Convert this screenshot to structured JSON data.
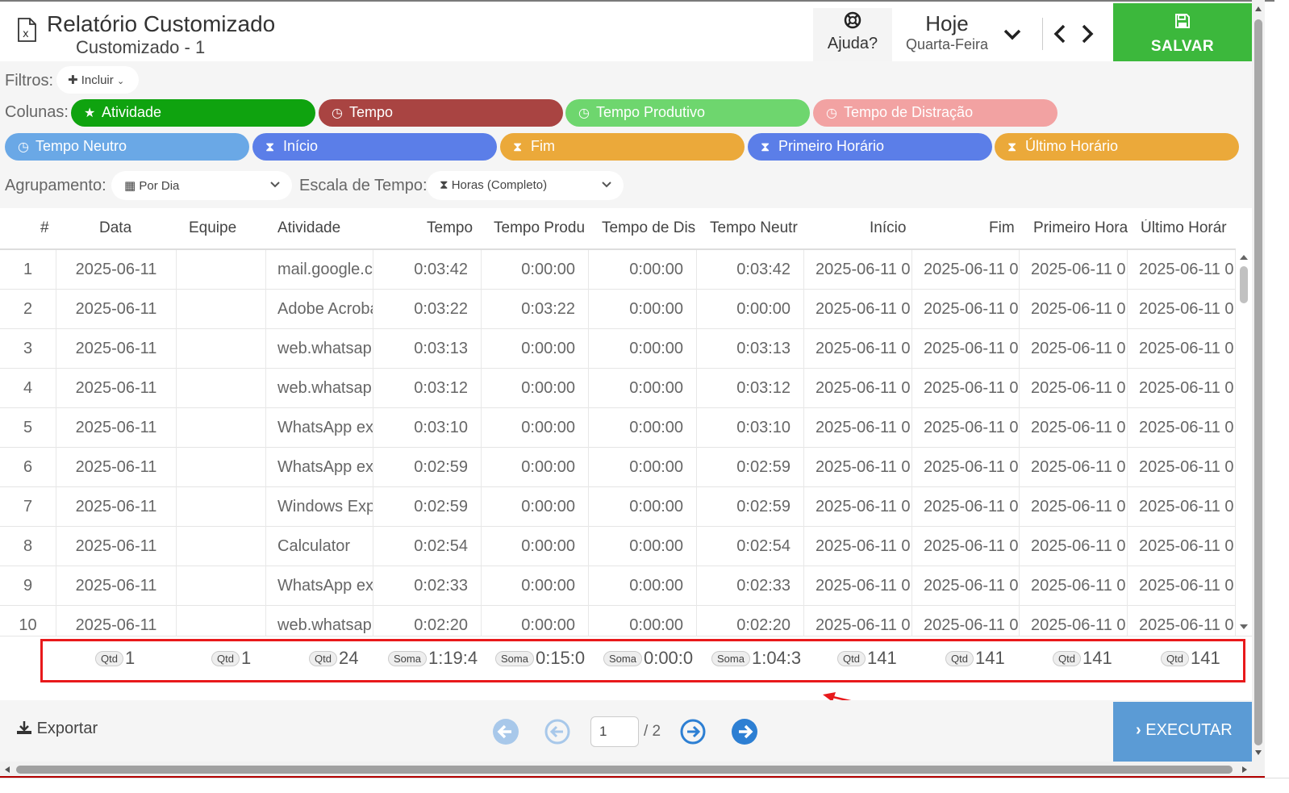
{
  "header": {
    "title": "Relatório Customizado",
    "subtitle": "Customizado - 1",
    "help_label": "Ajuda?",
    "date_main": "Hoje",
    "date_sub": "Quarta-Feira",
    "save_label": "SALVAR"
  },
  "filters": {
    "filters_label": "Filtros:",
    "include_label": "Incluir",
    "columns_label": "Colunas:",
    "columns": [
      {
        "label": "Atividade",
        "icon": "star-icon",
        "color": "#0fa30f"
      },
      {
        "label": "Tempo",
        "icon": "clock-icon",
        "color": "#a94442"
      },
      {
        "label": "Tempo Produtivo",
        "icon": "clock-icon",
        "color": "#6ed66e"
      },
      {
        "label": "Tempo de Distração",
        "icon": "clock-icon",
        "color": "#f2a2a2"
      },
      {
        "label": "Tempo Neutro",
        "icon": "clock-icon",
        "color": "#6aa8e6"
      },
      {
        "label": "Início",
        "icon": "hourglass-icon",
        "color": "#5b7ee8"
      },
      {
        "label": "Fim",
        "icon": "hourglass-icon",
        "color": "#eba93a"
      },
      {
        "label": "Primeiro Horário",
        "icon": "hourglass-icon",
        "color": "#5b7ee8"
      },
      {
        "label": "Último Horário",
        "icon": "hourglass-icon",
        "color": "#eba93a"
      }
    ],
    "grouping_label": "Agrupamento:",
    "grouping_value": "Por Dia",
    "timescale_label": "Escala de Tempo:",
    "timescale_value": "Horas (Completo)"
  },
  "table": {
    "headers": [
      "#",
      "Data",
      "Equipe",
      "Atividade",
      "Tempo",
      "Tempo Produ",
      "Tempo de Dis",
      "Tempo Neutr",
      "Início",
      "Fim",
      "Primeiro Hora",
      "Último Horár"
    ],
    "rows": [
      [
        "1",
        "2025-06-11",
        "",
        "mail.google.co",
        "0:03:42",
        "0:00:00",
        "0:00:00",
        "0:03:42",
        "2025-06-11 0",
        "2025-06-11 0",
        "2025-06-11 0",
        "2025-06-11 0"
      ],
      [
        "2",
        "2025-06-11",
        "",
        "Adobe Acrobat",
        "0:03:22",
        "0:03:22",
        "0:00:00",
        "0:00:00",
        "2025-06-11 0",
        "2025-06-11 0",
        "2025-06-11 0",
        "2025-06-11 0"
      ],
      [
        "3",
        "2025-06-11",
        "",
        "web.whatsapp",
        "0:03:13",
        "0:00:00",
        "0:00:00",
        "0:03:13",
        "2025-06-11 0",
        "2025-06-11 0",
        "2025-06-11 0",
        "2025-06-11 0"
      ],
      [
        "4",
        "2025-06-11",
        "",
        "web.whatsapp",
        "0:03:12",
        "0:00:00",
        "0:00:00",
        "0:03:12",
        "2025-06-11 0",
        "2025-06-11 0",
        "2025-06-11 0",
        "2025-06-11 0"
      ],
      [
        "5",
        "2025-06-11",
        "",
        "WhatsApp exe",
        "0:03:10",
        "0:00:00",
        "0:00:00",
        "0:03:10",
        "2025-06-11 0",
        "2025-06-11 0",
        "2025-06-11 0",
        "2025-06-11 0"
      ],
      [
        "6",
        "2025-06-11",
        "",
        "WhatsApp exe",
        "0:02:59",
        "0:00:00",
        "0:00:00",
        "0:02:59",
        "2025-06-11 0",
        "2025-06-11 0",
        "2025-06-11 0",
        "2025-06-11 0"
      ],
      [
        "7",
        "2025-06-11",
        "",
        "Windows Exp",
        "0:02:59",
        "0:00:00",
        "0:00:00",
        "0:02:59",
        "2025-06-11 0",
        "2025-06-11 0",
        "2025-06-11 0",
        "2025-06-11 0"
      ],
      [
        "8",
        "2025-06-11",
        "",
        "Calculator",
        "0:02:54",
        "0:00:00",
        "0:00:00",
        "0:02:54",
        "2025-06-11 0",
        "2025-06-11 0",
        "2025-06-11 0",
        "2025-06-11 0"
      ],
      [
        "9",
        "2025-06-11",
        "",
        "WhatsApp exe",
        "0:02:33",
        "0:00:00",
        "0:00:00",
        "0:02:33",
        "2025-06-11 0",
        "2025-06-11 0",
        "2025-06-11 0",
        "2025-06-11 0"
      ],
      [
        "10",
        "2025-06-11",
        "",
        "web.whatsapp",
        "0:02:20",
        "0:00:00",
        "0:00:00",
        "0:02:20",
        "2025-06-11 0",
        "2025-06-11 0",
        "2025-06-11 0",
        "2025-06-11 0"
      ]
    ],
    "footer": [
      {
        "badge": "Qtd",
        "value": "1"
      },
      {
        "badge": "Qtd",
        "value": "1"
      },
      {
        "badge": "Qtd",
        "value": "24"
      },
      {
        "badge": "Soma",
        "value": "1:19:4"
      },
      {
        "badge": "Soma",
        "value": "0:15:0"
      },
      {
        "badge": "Soma",
        "value": "0:00:0"
      },
      {
        "badge": "Soma",
        "value": "1:04:3"
      },
      {
        "badge": "Qtd",
        "value": "141"
      },
      {
        "badge": "Qtd",
        "value": "141"
      },
      {
        "badge": "Qtd",
        "value": "141"
      },
      {
        "badge": "Qtd",
        "value": "141"
      }
    ]
  },
  "pagination": {
    "current_page": "1",
    "total_label": "/ 2"
  },
  "bottom": {
    "export_label": "Exportar",
    "execute_label": "EXECUTAR"
  },
  "colors": {
    "save": "#3cb83c",
    "execute": "#5b9bd5",
    "highlight": "#e8191b"
  }
}
